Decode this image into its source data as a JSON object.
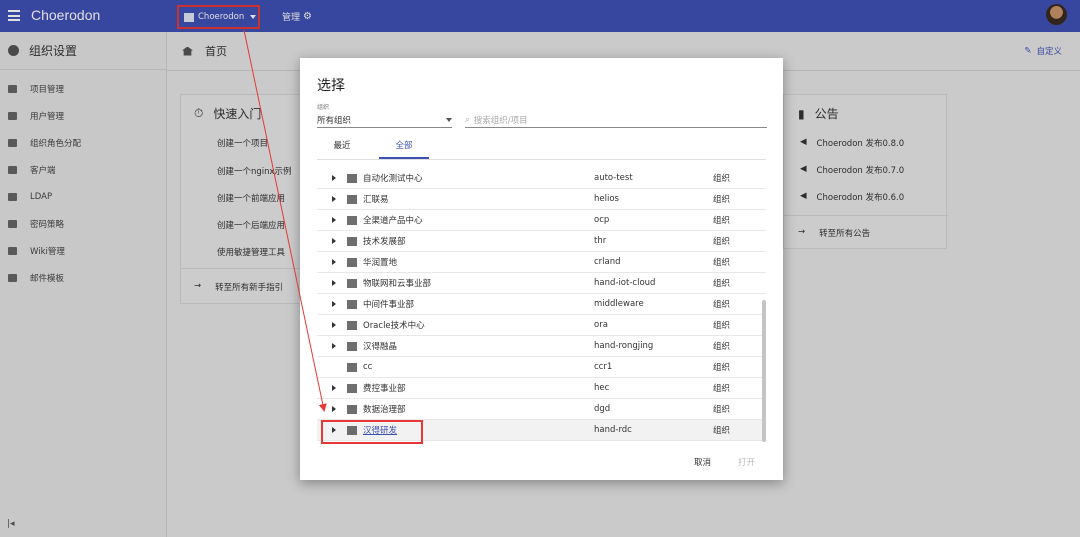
{
  "header": {
    "app_title": "Choerodon",
    "org_label": "Choerodon",
    "manage_label": "管理"
  },
  "sidebar": {
    "title": "组织设置",
    "items": [
      {
        "label": "项目管理"
      },
      {
        "label": "用户管理"
      },
      {
        "label": "组织角色分配"
      },
      {
        "label": "客户端"
      },
      {
        "label": "LDAP"
      },
      {
        "label": "密码策略"
      },
      {
        "label": "Wiki管理"
      },
      {
        "label": "邮件模板"
      }
    ]
  },
  "page": {
    "breadcrumb": "首页",
    "customize": "自定义"
  },
  "quick_start": {
    "title": "快速入门",
    "links": [
      "创建一个项目",
      "创建一个nginx示例",
      "创建一个前端应用",
      "创建一个后端应用",
      "使用敏捷管理工具"
    ],
    "footer": "转至所有新手指引"
  },
  "announcements": {
    "title": "公告",
    "items": [
      "Choerodon 发布0.8.0",
      "Choerodon 发布0.7.0",
      "Choerodon 发布0.6.0"
    ],
    "footer": "转至所有公告"
  },
  "modal": {
    "title": "选择",
    "field_label": "组织",
    "select_value": "所有组织",
    "search_placeholder": "搜索组织/项目",
    "tabs": [
      {
        "label": "最近"
      },
      {
        "label": "全部",
        "active": true
      }
    ],
    "rows": [
      {
        "name": "自动化测试中心",
        "code": "auto-test",
        "type": "组织",
        "expandable": true
      },
      {
        "name": "汇联易",
        "code": "helios",
        "type": "组织",
        "expandable": true
      },
      {
        "name": "全渠道产品中心",
        "code": "ocp",
        "type": "组织",
        "expandable": true
      },
      {
        "name": "技术发展部",
        "code": "thr",
        "type": "组织",
        "expandable": true
      },
      {
        "name": "华润置地",
        "code": "crland",
        "type": "组织",
        "expandable": true
      },
      {
        "name": "物联网和云事业部",
        "code": "hand-iot-cloud",
        "type": "组织",
        "expandable": true
      },
      {
        "name": "中间件事业部",
        "code": "middleware",
        "type": "组织",
        "expandable": true
      },
      {
        "name": "Oracle技术中心",
        "code": "ora",
        "type": "组织",
        "expandable": true
      },
      {
        "name": "汉得融晶",
        "code": "hand-rongjing",
        "type": "组织",
        "expandable": true
      },
      {
        "name": "cc",
        "code": "ccr1",
        "type": "组织",
        "expandable": false
      },
      {
        "name": "费控事业部",
        "code": "hec",
        "type": "组织",
        "expandable": true
      },
      {
        "name": "数据治理部",
        "code": "dgd",
        "type": "组织",
        "expandable": true
      },
      {
        "name": "汉得研发",
        "code": "hand-rdc",
        "type": "组织",
        "expandable": true,
        "selected": true
      }
    ],
    "cancel_label": "取消",
    "open_label": "打开"
  },
  "colors": {
    "primary": "#3f51b5",
    "highlight": "#e53935"
  }
}
